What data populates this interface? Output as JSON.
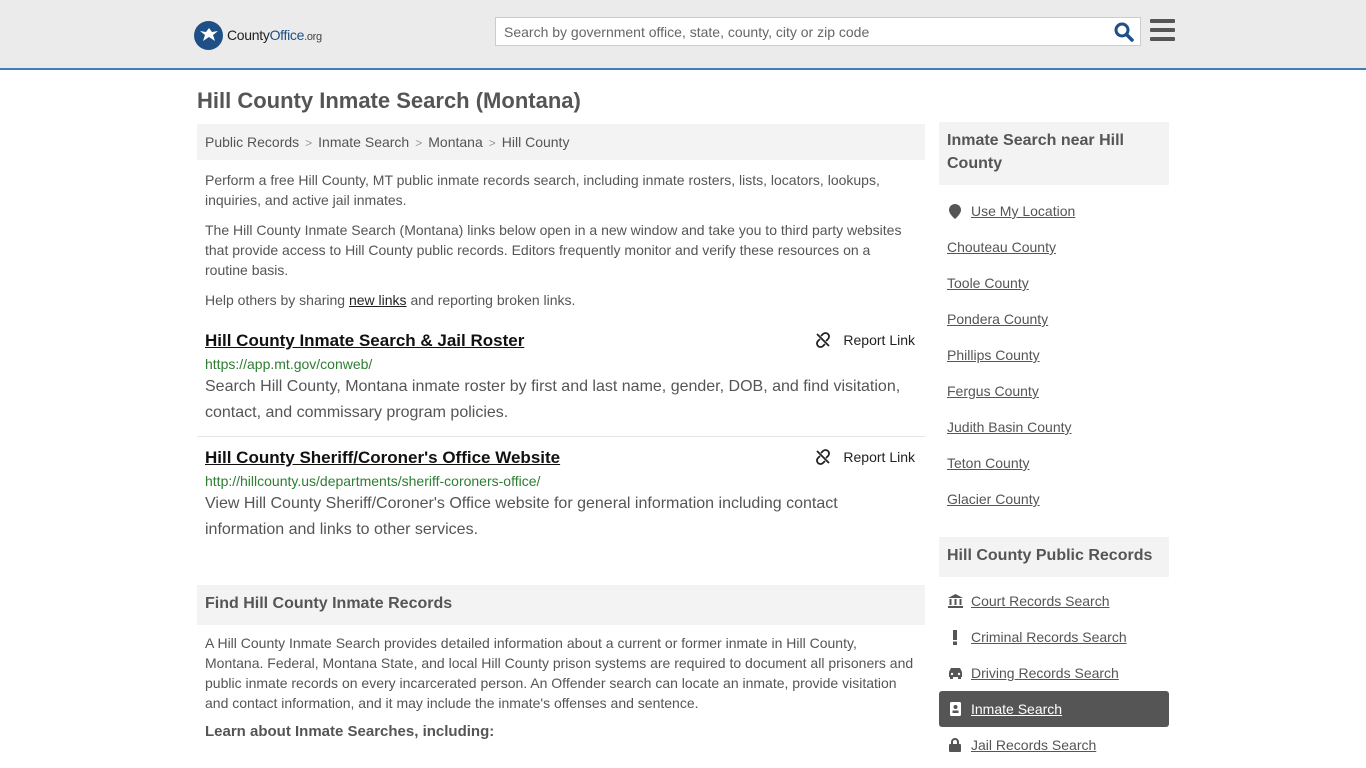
{
  "header": {
    "logo_text_prefix": "County",
    "logo_text_brand": "Office",
    "logo_text_tld": ".org",
    "search_placeholder": "Search by government office, state, county, city or zip code"
  },
  "page_title": "Hill County Inmate Search (Montana)",
  "breadcrumb": [
    "Public Records",
    "Inmate Search",
    "Montana",
    "Hill County"
  ],
  "intro": {
    "p1": "Perform a free Hill County, MT public inmate records search, including inmate rosters, lists, locators, lookups, inquiries, and active jail inmates.",
    "p2": "The Hill County Inmate Search (Montana) links below open in a new window and take you to third party websites that provide access to Hill County public records. Editors frequently monitor and verify these resources on a routine basis.",
    "p3_before": "Help others by sharing ",
    "p3_link": "new links",
    "p3_after": " and reporting broken links."
  },
  "results": [
    {
      "title": "Hill County Inmate Search & Jail Roster",
      "url": "https://app.mt.gov/conweb/",
      "description": "Search Hill County, Montana inmate roster by first and last name, gender, DOB, and find visitation, contact, and commissary program policies.",
      "report_label": "Report Link"
    },
    {
      "title": "Hill County Sheriff/Coroner's Office Website",
      "url": "http://hillcounty.us/departments/sheriff-coroners-office/",
      "description": "View Hill County Sheriff/Coroner's Office website for general information including contact information and links to other services.",
      "report_label": "Report Link"
    }
  ],
  "find_section": {
    "heading": "Find Hill County Inmate Records",
    "text": "A Hill County Inmate Search provides detailed information about a current or former inmate in Hill County, Montana. Federal, Montana State, and local Hill County prison systems are required to document all prisoners and public inmate records on every incarcerated person. An Offender search can locate an inmate, provide visitation and contact information, and it may include the inmate's offenses and sentence.",
    "learn_heading": "Learn about Inmate Searches, including:"
  },
  "sidebar": {
    "nearby_heading": "Inmate Search near Hill County",
    "nearby_items": [
      {
        "label": "Use My Location",
        "icon": "location-pin-icon"
      },
      {
        "label": "Chouteau County"
      },
      {
        "label": "Toole County"
      },
      {
        "label": "Pondera County"
      },
      {
        "label": "Phillips County"
      },
      {
        "label": "Fergus County"
      },
      {
        "label": "Judith Basin County"
      },
      {
        "label": "Teton County"
      },
      {
        "label": "Glacier County"
      }
    ],
    "records_heading": "Hill County Public Records",
    "records_items": [
      {
        "label": "Court Records Search",
        "icon": "courthouse-icon"
      },
      {
        "label": "Criminal Records Search",
        "icon": "exclamation-icon"
      },
      {
        "label": "Driving Records Search",
        "icon": "car-icon"
      },
      {
        "label": "Inmate Search",
        "icon": "inmate-badge-icon",
        "active": true
      },
      {
        "label": "Jail Records Search",
        "icon": "lock-icon"
      }
    ]
  },
  "colors": {
    "accent_blue": "#3e7fb8",
    "brand_navy": "#1e4f86",
    "url_green": "#2e7d32",
    "active_bg": "#555555"
  }
}
